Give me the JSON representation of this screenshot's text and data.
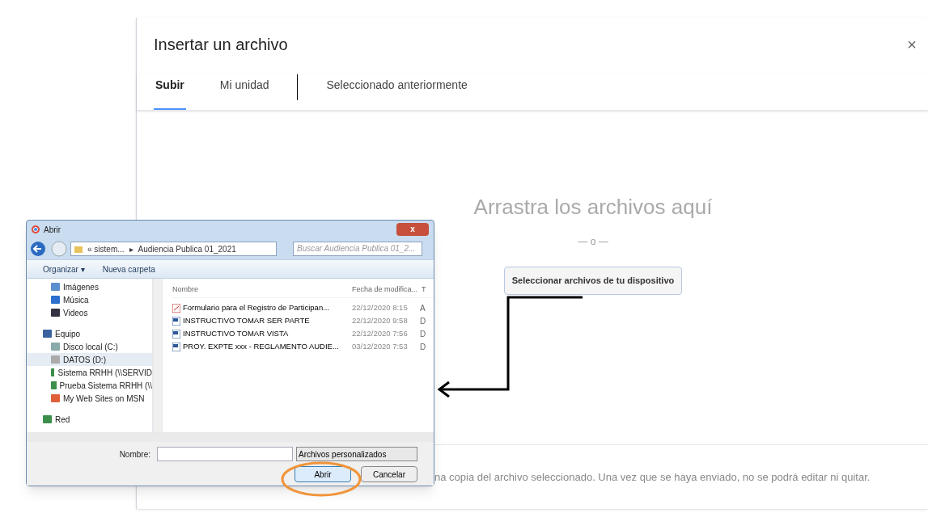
{
  "upload_dialog": {
    "title": "Insertar un archivo",
    "close": "×",
    "tabs": [
      {
        "label": "Subir",
        "selected": true
      },
      {
        "label": "Mi unidad",
        "selected": false
      },
      {
        "label": "Seleccionado anteriormente",
        "selected": false
      }
    ],
    "drop_text": "Arrastra los archivos aquí",
    "separator": "— o —",
    "select_button": "Seleccionar archivos de tu dispositivo",
    "footer_note": "na copia del archivo seleccionado. Una vez que se haya enviado, no se podrá editar ni quitar."
  },
  "open_dialog": {
    "title": "Abrir",
    "close": "x",
    "breadcrumb": [
      "«  sistem...",
      "Audiencia Publica 01_2021"
    ],
    "breadcrumb_separator": "▸",
    "search_placeholder": "Buscar Audiencia Publica 01_2...",
    "toolbar": [
      "Organizar ▾",
      "Nueva carpeta"
    ],
    "nav": [
      {
        "label": "Imágenes",
        "kind": "pictures",
        "selected": false
      },
      {
        "label": "Música",
        "kind": "music",
        "selected": false
      },
      {
        "label": "Videos",
        "kind": "video",
        "selected": false
      },
      {
        "label": "Equipo",
        "kind": "computer",
        "selected": false,
        "children": [
          {
            "label": "Disco local (C:)",
            "kind": "disk",
            "selected": false
          },
          {
            "label": "DATOS (D:)",
            "kind": "drive",
            "selected": true
          },
          {
            "label": "Sistema RRHH (\\\\SERVID",
            "kind": "network",
            "selected": false
          },
          {
            "label": "Prueba Sistema RRHH (\\\\",
            "kind": "network",
            "selected": false
          },
          {
            "label": "My Web Sites on MSN",
            "kind": "web",
            "selected": false
          }
        ]
      },
      {
        "label": "Red",
        "kind": "network",
        "selected": false
      }
    ],
    "columns": [
      "Nombre",
      "Fecha de modifica...",
      "T"
    ],
    "files": [
      {
        "name": "Formulario para el Registro de Participan...",
        "date": "22/12/2020 8:15",
        "type": "A",
        "kind": "pdf"
      },
      {
        "name": "INSTRUCTIVO TOMAR SER PARTE",
        "date": "22/12/2020 9:58",
        "type": "D",
        "kind": "doc"
      },
      {
        "name": "INSTRUCTIVO TOMAR VISTA",
        "date": "22/12/2020 7:56",
        "type": "D",
        "kind": "doc"
      },
      {
        "name": "PROY. EXPTE xxx - REGLAMENTO AUDIE...",
        "date": "03/12/2020 7:53",
        "type": "D",
        "kind": "doc"
      }
    ],
    "filename_label": "Nombre:",
    "filter": "Archivos personalizados",
    "buttons": [
      "Abrir",
      "Cancelar"
    ]
  }
}
